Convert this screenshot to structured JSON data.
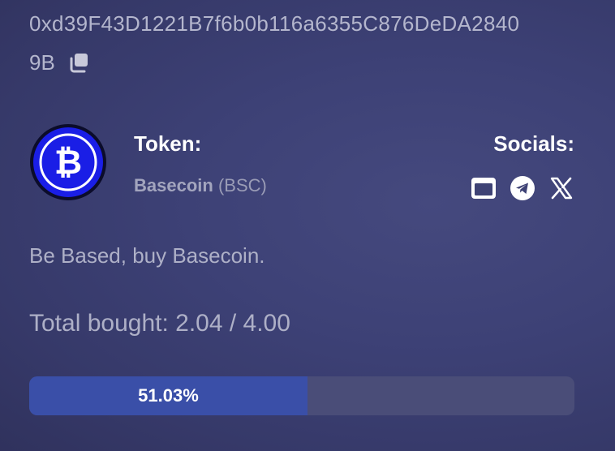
{
  "address": {
    "line1": "0xd39F43D1221B7f6b0b116a6355C876DeDA2840",
    "line2": "9B",
    "copy_icon": "copy-icon"
  },
  "token": {
    "label": "Token:",
    "name": "Basecoin",
    "symbol": "(BSC)",
    "logo_icon": "bitcoin-icon",
    "logo_color": "#1a1ee6"
  },
  "socials": {
    "label": "Socials:",
    "items": [
      {
        "icon": "website-icon"
      },
      {
        "icon": "telegram-icon"
      },
      {
        "icon": "x-twitter-icon"
      }
    ]
  },
  "description": "Be Based, buy Basecoin.",
  "progress": {
    "total_label": "Total bought: 2.04 / 4.00",
    "percent_label": "51.03%",
    "fraction": 0.5103,
    "fill_color": "#3a4fa8",
    "track_color": "#4a4d78"
  }
}
